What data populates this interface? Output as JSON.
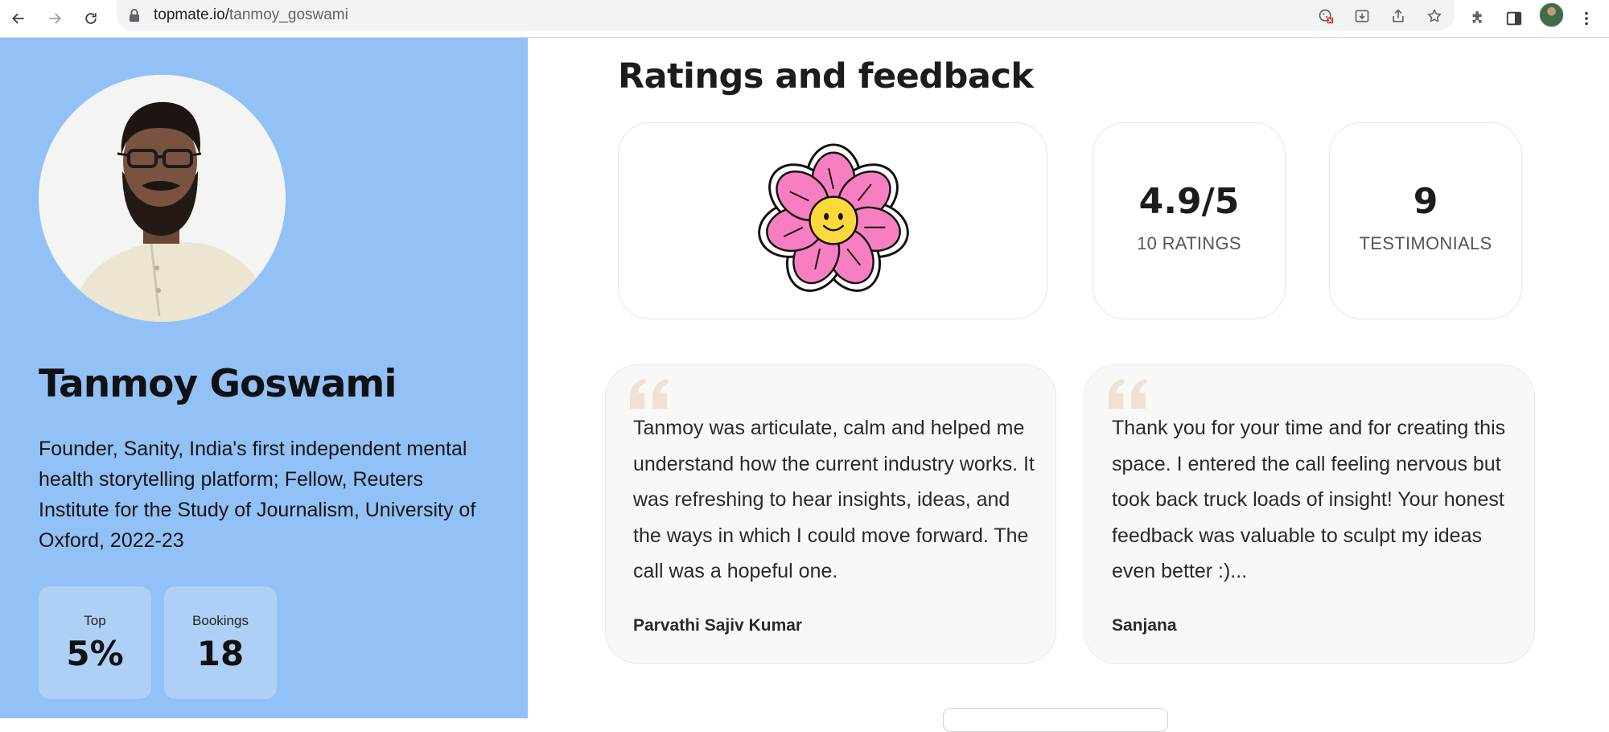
{
  "browser": {
    "url_host": "topmate.io/",
    "url_path": "tanmoy_goswami"
  },
  "profile": {
    "name": "Tanmoy Goswami",
    "bio": "Founder, Sanity, India's first independent mental health storytelling platform; Fellow, Reuters Institute for the Study of Journalism, University of Oxford, 2022-23",
    "stats": [
      {
        "label": "Top",
        "value": "5%"
      },
      {
        "label": "Bookings",
        "value": "18"
      }
    ]
  },
  "ratings": {
    "title": "Ratings and feedback",
    "score": "4.9/5",
    "score_label": "10 RATINGS",
    "testimonials_count": "9",
    "testimonials_label": "TESTIMONIALS"
  },
  "testimonials": [
    {
      "text": "Tanmoy was articulate, calm and helped me understand how the current industry works. It was refreshing to hear insights, ideas, and the ways in which I could move forward. The call was a hopeful one.",
      "author": "Parvathi Sajiv Kumar"
    },
    {
      "text": "Thank you for your time and for creating this space. I entered the call feeling nervous but took back truck loads of insight! Your honest feedback was valuable to sculpt my ideas even better :)...",
      "author": "Sanjana"
    }
  ],
  "colors": {
    "sidebar_bg": "#91c1f6",
    "stat_box_bg": "#aed0f7",
    "quote_card_bg": "#faf8f6",
    "quote_mark": "#efe1d3",
    "flower_petal": "#f77fc1",
    "flower_center": "#ffd93b"
  },
  "icons": {
    "back": "back-arrow-icon",
    "forward": "forward-arrow-icon",
    "reload": "reload-icon",
    "lock": "lock-icon",
    "flower": "smiling-flower-illustration",
    "quote": "quote-mark-icon"
  }
}
